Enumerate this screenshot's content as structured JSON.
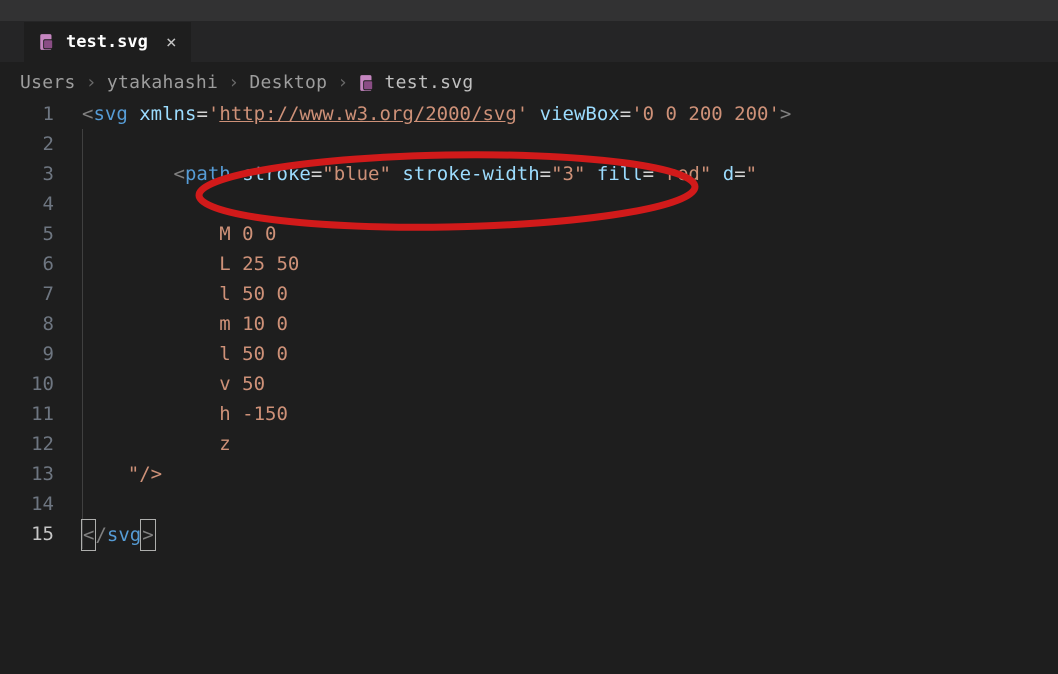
{
  "tab": {
    "filename": "test.svg",
    "closeGlyph": "×"
  },
  "breadcrumbs": {
    "items": [
      "Users",
      "ytakahashi",
      "Desktop"
    ],
    "file": "test.svg",
    "separator": "›"
  },
  "lineNumbers": [
    "1",
    "2",
    "3",
    "4",
    "5",
    "6",
    "7",
    "8",
    "9",
    "10",
    "11",
    "12",
    "13",
    "14",
    "15"
  ],
  "activeLine": 15,
  "code": {
    "line1": {
      "lt": "<",
      "tag": "svg",
      "sp1": " ",
      "attr1": "xmlns",
      "eq": "=",
      "q": "'",
      "url": "http://www.w3.org/2000/svg",
      "sp2": " ",
      "attr2": "viewBox",
      "val2": "'0 0 200 200'",
      "gt": ">"
    },
    "line2": "",
    "line3": {
      "indent": "        ",
      "lt": "<",
      "tag": "path",
      "sp": " ",
      "a1": "stroke",
      "v1": "\"blue\"",
      "a2": "stroke-width",
      "v2": "\"3\"",
      "a3": "fill",
      "v3": "\"red\"",
      "a4": "d",
      "v4open": "\""
    },
    "line5": "            M 0 0",
    "line6": "            L 25 50",
    "line7": "            l 50 0",
    "line8": "            m 10 0",
    "line9": "            l 50 0",
    "line10": "            v 50",
    "line11": "            h -150",
    "line12": "            z",
    "line13": {
      "indent": "    ",
      "close": "\"/>"
    },
    "line15": {
      "lt_open": "<",
      "slash": "/",
      "tag": "svg",
      "gt": ">"
    }
  },
  "colors": {
    "background": "#1e1e1e",
    "tabsBg": "#252526",
    "tag": "#569cd6",
    "attr": "#9cdcfe",
    "string": "#ce9178",
    "bracket": "#808080",
    "lineNum": "#6e7681",
    "annotation": "#d11a1a"
  }
}
